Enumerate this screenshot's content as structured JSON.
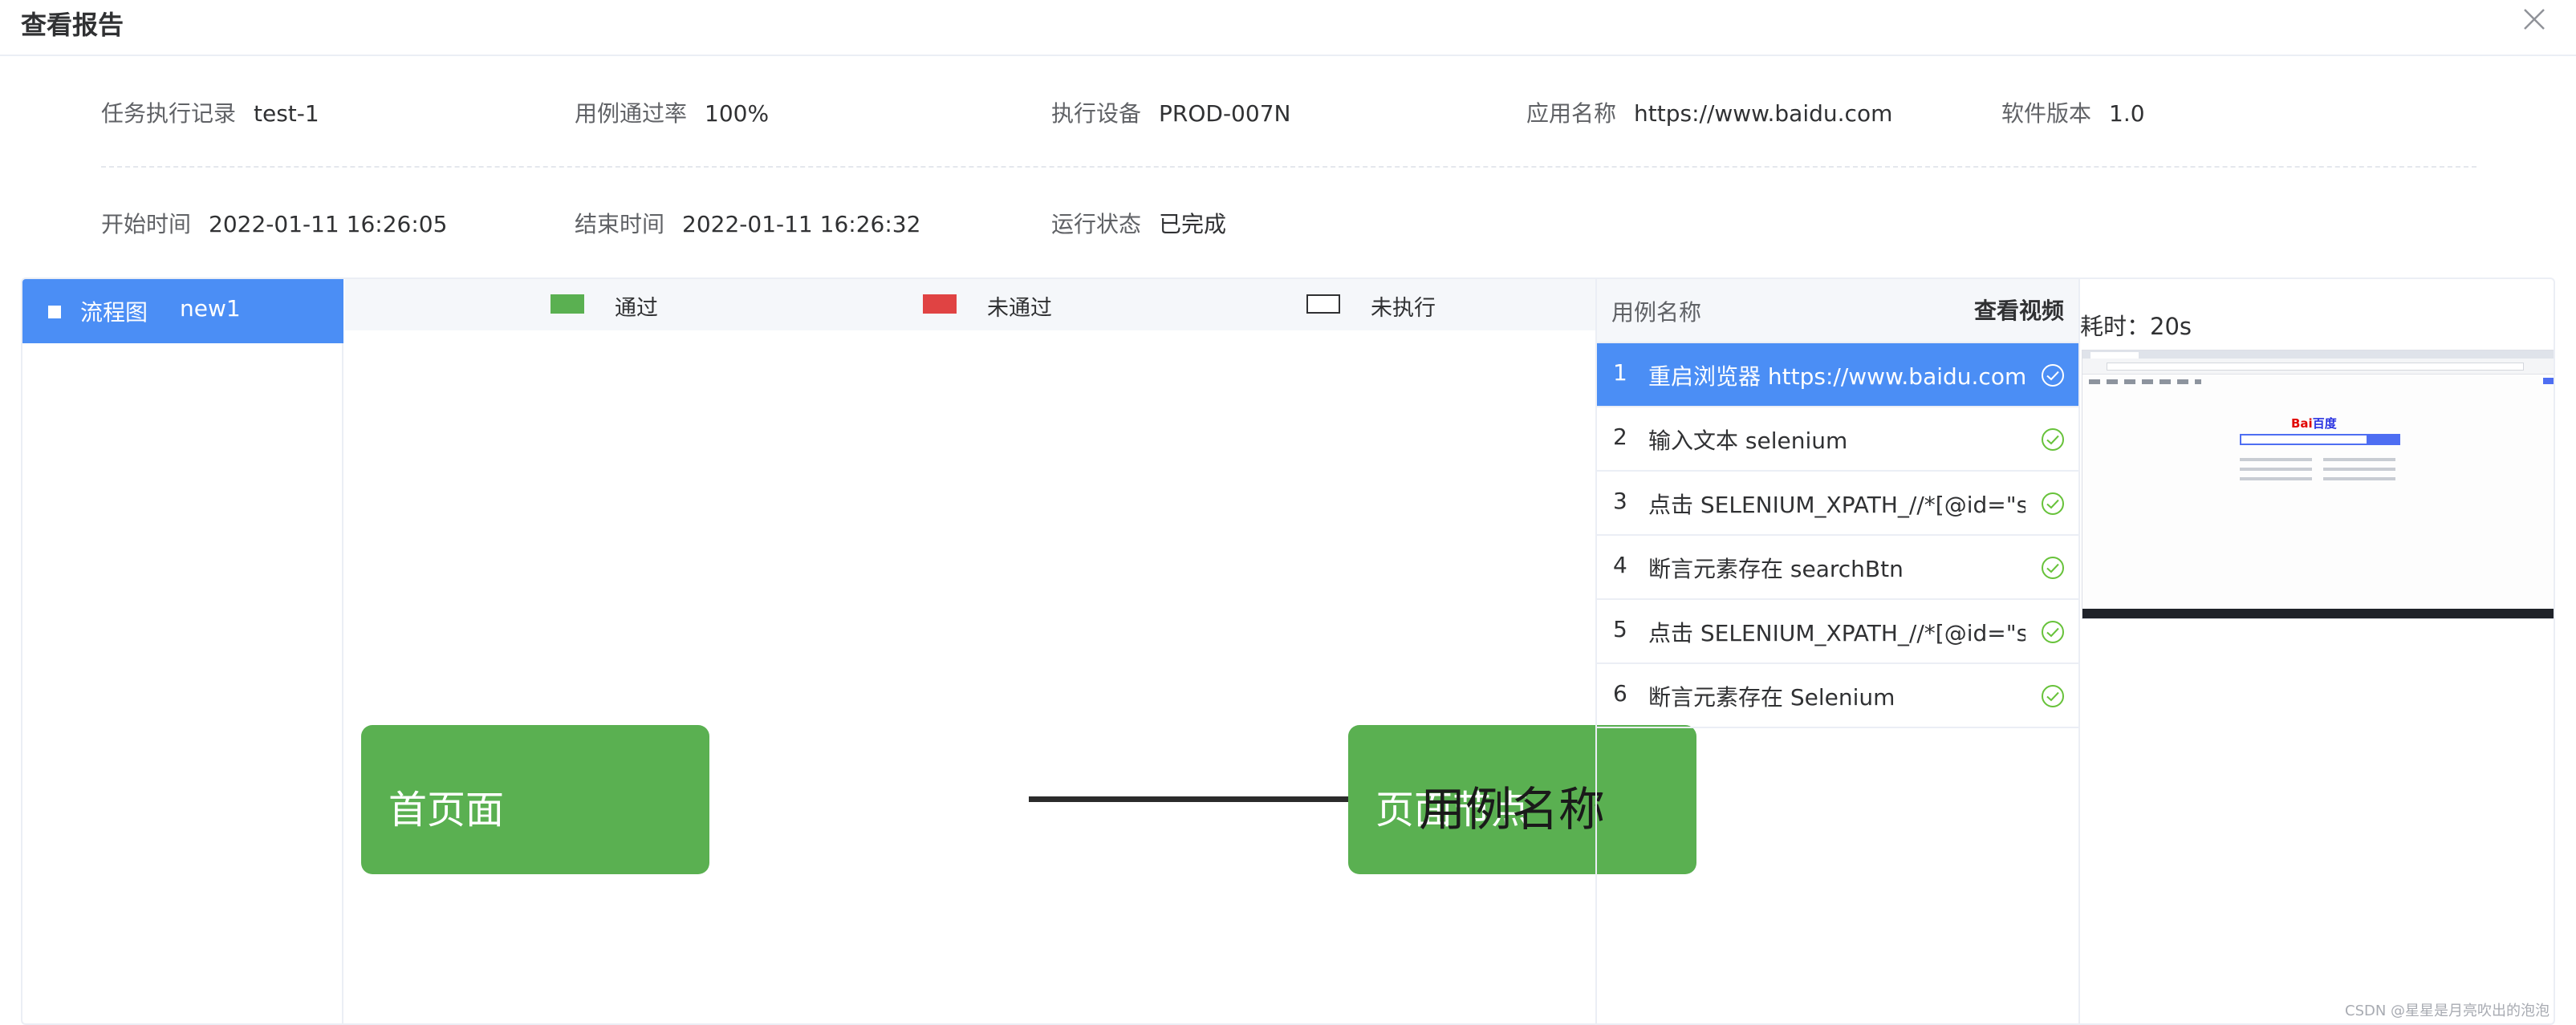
{
  "modal": {
    "title": "查看报告"
  },
  "info": {
    "record_label": "任务执行记录",
    "record_value": "test-1",
    "passrate_label": "用例通过率",
    "passrate_value": "100%",
    "device_label": "执行设备",
    "device_value": "PROD-007N",
    "app_label": "应用名称",
    "app_value": "https://www.baidu.com",
    "version_label": "软件版本",
    "version_value": "1.0",
    "start_label": "开始时间",
    "start_value": "2022-01-11 16:26:05",
    "end_label": "结束时间",
    "end_value": "2022-01-11 16:26:32",
    "status_label": "运行状态",
    "status_value": "已完成"
  },
  "nav": {
    "label": "流程图",
    "value": "new1"
  },
  "legend": {
    "pass": {
      "label": "通过",
      "color": "#5ab051"
    },
    "fail": {
      "label": "未通过",
      "color": "#e04343"
    },
    "none": {
      "label": "未执行",
      "color": "#ffffff"
    }
  },
  "flow": {
    "node1": "首页面",
    "node2": "页面节点",
    "caption": "用例名称",
    "node_color": "#5ab051"
  },
  "cases": {
    "header_name": "用例名称",
    "header_video": "查看视频",
    "items": [
      {
        "index": "1",
        "text": "重启浏览器 https://www.baidu.com",
        "status": "pass"
      },
      {
        "index": "2",
        "text": "输入文本 selenium",
        "status": "pass"
      },
      {
        "index": "3",
        "text": "点击 SELENIUM_XPATH_//*[@id=\"su\"]",
        "status": "pass"
      },
      {
        "index": "4",
        "text": "断言元素存在 searchBtn",
        "status": "pass"
      },
      {
        "index": "5",
        "text": "点击 SELENIUM_XPATH_//*[@id=\"su\"]",
        "status": "pass"
      },
      {
        "index": "6",
        "text": "断言元素存在 Selenium",
        "status": "pass"
      }
    ]
  },
  "preview": {
    "elapsed": "耗时：20s",
    "logo_a": "Bai",
    "logo_b": "百度"
  },
  "watermark": "CSDN @星星是月亮吹出的泡泡",
  "colors": {
    "accent": "#4b8ef5",
    "pass": "#5ab051",
    "check": "#67c23a"
  }
}
